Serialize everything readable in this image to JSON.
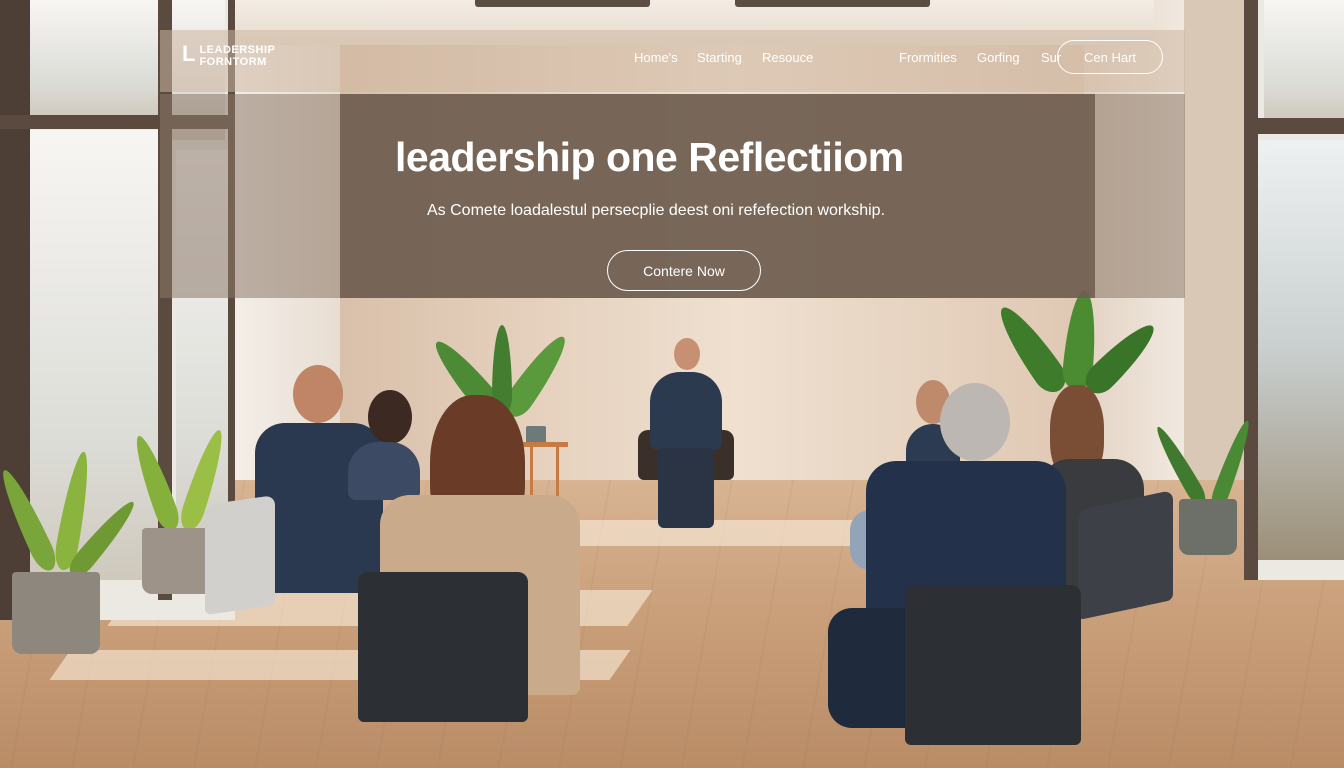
{
  "brand": {
    "mark": "L",
    "line1": "LEADERSHIP",
    "line2": "FORNTORM"
  },
  "nav": {
    "links": [
      "Home's",
      "Starting",
      "Resouce",
      "Frormities",
      "Gorfing",
      "Sur"
    ],
    "cta_label": "Cen Hart"
  },
  "hero": {
    "title": "leadership one Reflectiiom",
    "subtitle": "As Comete loadalestul persecplie deest oni refefection workship.",
    "cta_label": "Contere Now"
  },
  "colors": {
    "overlay_panel": "#6c5c4e",
    "nav_bar": "#cdb6a0",
    "text": "#ffffff"
  }
}
